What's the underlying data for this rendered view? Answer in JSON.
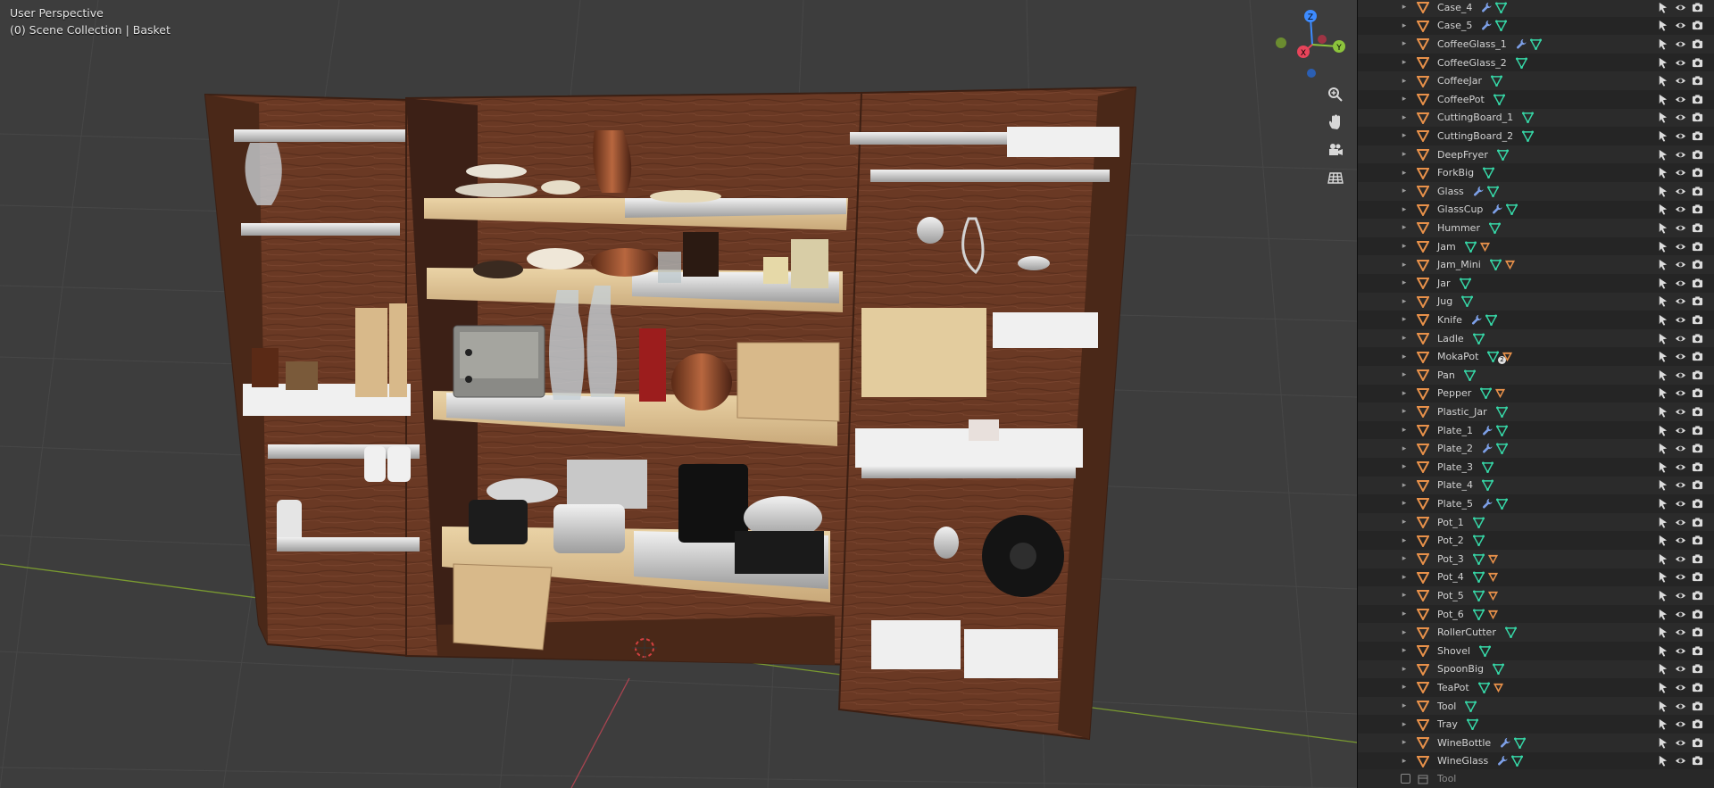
{
  "viewport": {
    "header_title": "User Perspective",
    "header_subtitle": "(0) Scene Collection | Basket",
    "gizmo": {
      "x_label": "X",
      "y_label": "Y",
      "z_label": "Z"
    },
    "nav_icons": [
      "zoom-icon",
      "hand-pan-icon",
      "camera-icon",
      "grid-ortho-icon"
    ]
  },
  "colors": {
    "viewport_bg": "#3d3d3d",
    "outliner_bg": "#282828",
    "mesh_icon": "#e8914a",
    "modifier_icon": "#7da0e8",
    "data_icon": "#36d6a6",
    "axis_x": "#e8445a",
    "axis_y": "#8cc43c",
    "axis_z": "#3d8bff"
  },
  "outliner": {
    "items": [
      {
        "name": "Case_4",
        "mods": [
          "wrench",
          "tri"
        ]
      },
      {
        "name": "Case_5",
        "mods": [
          "wrench",
          "tri"
        ]
      },
      {
        "name": "CoffeeGlass_1",
        "mods": [
          "wrench",
          "tri"
        ]
      },
      {
        "name": "CoffeeGlass_2",
        "mods": [
          "tri"
        ]
      },
      {
        "name": "CoffeeJar",
        "mods": [
          "tri"
        ]
      },
      {
        "name": "CoffeePot",
        "mods": [
          "tri"
        ]
      },
      {
        "name": "CuttingBoard_1",
        "mods": [
          "tri"
        ]
      },
      {
        "name": "CuttingBoard_2",
        "mods": [
          "tri"
        ]
      },
      {
        "name": "DeepFryer",
        "mods": [
          "tri"
        ]
      },
      {
        "name": "ForkBig",
        "mods": [
          "tri"
        ]
      },
      {
        "name": "Glass",
        "mods": [
          "wrench",
          "tri"
        ]
      },
      {
        "name": "GlassCup",
        "mods": [
          "wrench",
          "tri"
        ]
      },
      {
        "name": "Hummer",
        "mods": [
          "tri"
        ]
      },
      {
        "name": "Jam",
        "mods": [
          "tri",
          "otri"
        ]
      },
      {
        "name": "Jam_Mini",
        "mods": [
          "tri",
          "otri"
        ]
      },
      {
        "name": "Jar",
        "mods": [
          "tri"
        ]
      },
      {
        "name": "Jug",
        "mods": [
          "tri"
        ]
      },
      {
        "name": "Knife",
        "mods": [
          "wrench",
          "tri"
        ]
      },
      {
        "name": "Ladle",
        "mods": [
          "tri"
        ]
      },
      {
        "name": "MokaPot",
        "mods": [
          "tri",
          "otri2"
        ],
        "badge": "2"
      },
      {
        "name": "Pan",
        "mods": [
          "tri"
        ]
      },
      {
        "name": "Pepper",
        "mods": [
          "tri",
          "otri"
        ]
      },
      {
        "name": "Plastic_Jar",
        "mods": [
          "tri"
        ]
      },
      {
        "name": "Plate_1",
        "mods": [
          "wrench",
          "tri"
        ]
      },
      {
        "name": "Plate_2",
        "mods": [
          "wrench",
          "tri"
        ]
      },
      {
        "name": "Plate_3",
        "mods": [
          "tri"
        ]
      },
      {
        "name": "Plate_4",
        "mods": [
          "tri"
        ]
      },
      {
        "name": "Plate_5",
        "mods": [
          "wrench",
          "tri"
        ]
      },
      {
        "name": "Pot_1",
        "mods": [
          "tri"
        ]
      },
      {
        "name": "Pot_2",
        "mods": [
          "tri"
        ]
      },
      {
        "name": "Pot_3",
        "mods": [
          "tri",
          "otri"
        ]
      },
      {
        "name": "Pot_4",
        "mods": [
          "tri",
          "otri"
        ]
      },
      {
        "name": "Pot_5",
        "mods": [
          "tri",
          "otri"
        ]
      },
      {
        "name": "Pot_6",
        "mods": [
          "tri",
          "otri"
        ]
      },
      {
        "name": "RollerCutter",
        "mods": [
          "tri"
        ]
      },
      {
        "name": "Shovel",
        "mods": [
          "tri"
        ]
      },
      {
        "name": "SpoonBig",
        "mods": [
          "tri"
        ]
      },
      {
        "name": "TeaPot",
        "mods": [
          "tri",
          "otri"
        ]
      },
      {
        "name": "Tool",
        "mods": [
          "tri"
        ]
      },
      {
        "name": "Tray",
        "mods": [
          "tri"
        ]
      },
      {
        "name": "WineBottle",
        "mods": [
          "wrench",
          "tri"
        ]
      },
      {
        "name": "WineGlass",
        "mods": [
          "wrench",
          "tri"
        ]
      }
    ],
    "collection_row": {
      "name": "Tool",
      "checkbox": false
    }
  }
}
